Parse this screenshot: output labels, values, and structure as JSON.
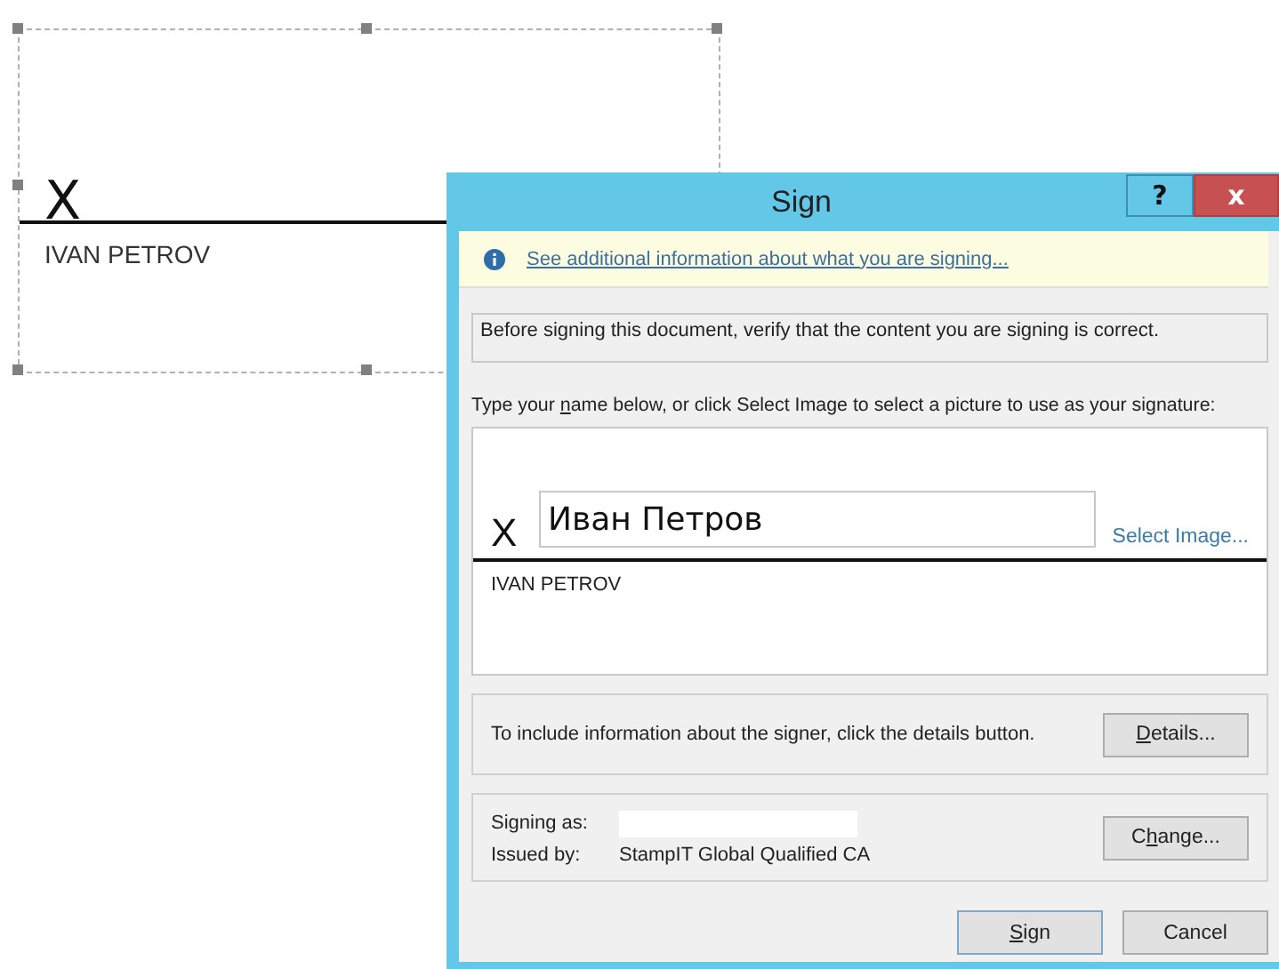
{
  "document_signature_line": {
    "mark": "X",
    "signer_name": "IVAN PETROV",
    "selected": true
  },
  "dialog": {
    "title": "Sign",
    "help_button": "?",
    "close_button": "x",
    "info_link": "See additional information about what you are signing...",
    "statement": "Before signing this document, verify that the content you are signing is correct.",
    "instruction_parts": [
      {
        "text": "Type your ",
        "underlined": false
      },
      {
        "text": "n",
        "underlined": true
      },
      {
        "text": "ame below, or click Select Image to select a picture to use as your signature:",
        "underlined": false
      }
    ],
    "signature": {
      "mark": "X",
      "value": "Иван Петров",
      "select_image_link": "Select Image...",
      "signer_name": "IVAN PETROV"
    },
    "details_text": "To include information about the signer, click the details button.",
    "details_button_parts": [
      {
        "text": "D",
        "underlined": true
      },
      {
        "text": "etails...",
        "underlined": false
      }
    ],
    "signing_as_label": "Signing as:",
    "issued_by_label": "Issued by:",
    "issued_by_value": "StampIT Global Qualified CA",
    "change_button_parts": [
      {
        "text": "C",
        "underlined": false
      },
      {
        "text": "h",
        "underlined": true
      },
      {
        "text": "ange...",
        "underlined": false
      }
    ],
    "buttons": [
      {
        "parts": [
          {
            "text": "S",
            "underlined": true
          },
          {
            "text": "ign",
            "underlined": false
          }
        ],
        "default": true
      },
      {
        "parts": [
          {
            "text": "Cancel",
            "underlined": false
          }
        ],
        "default": false
      }
    ]
  }
}
